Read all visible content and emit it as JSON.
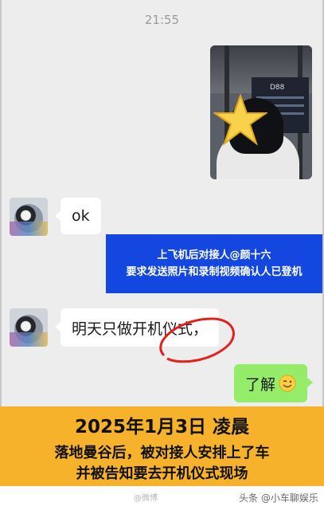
{
  "chat": {
    "timestamp": "21:55",
    "photo_board_text": "D88",
    "messages": [
      {
        "side": "left",
        "text": "ok"
      },
      {
        "side": "left",
        "text": "明天只做开机仪式，"
      },
      {
        "side": "right",
        "text": "了解"
      }
    ]
  },
  "caption": {
    "line1": "上飞机后对接人@颜十六",
    "line2": "要求发送照片和录制视频确认人已登机"
  },
  "banner": {
    "title": "2025年1月3日 凌晨",
    "line1": "落地曼谷后，被对接人安排上了车",
    "line2": "并被告知要去开机仪式现场"
  },
  "footer": {
    "weibo_mark": "@微博",
    "watermark": "头条 @小车聊娱乐"
  },
  "colors": {
    "chat_bg": "#ededed",
    "green_bubble": "#95ec69",
    "blue_caption": "#1347e0",
    "orange_banner": "#f5b22a"
  },
  "icons": [
    "star-sticker-icon",
    "smile-emoji-icon",
    "avatar-image"
  ]
}
